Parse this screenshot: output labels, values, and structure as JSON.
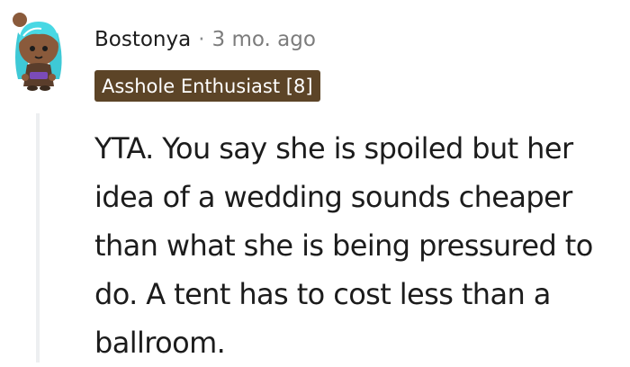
{
  "comment": {
    "author": "Bostonya",
    "separator": "·",
    "timestamp": "3 mo. ago",
    "flair": "Asshole Enthusiast [8]",
    "body": "YTA. You say she is spoiled but her idea of a wedding sounds cheaper than what she is being pressured to do. A tent has to cost less than a ballroom."
  },
  "colors": {
    "flair_background": "#5c4427",
    "flair_text": "#ffffff",
    "thread_line": "#edeff1",
    "meta_text": "#7c7c7c"
  },
  "icons": {
    "avatar": "snoo-avatar-icon"
  }
}
